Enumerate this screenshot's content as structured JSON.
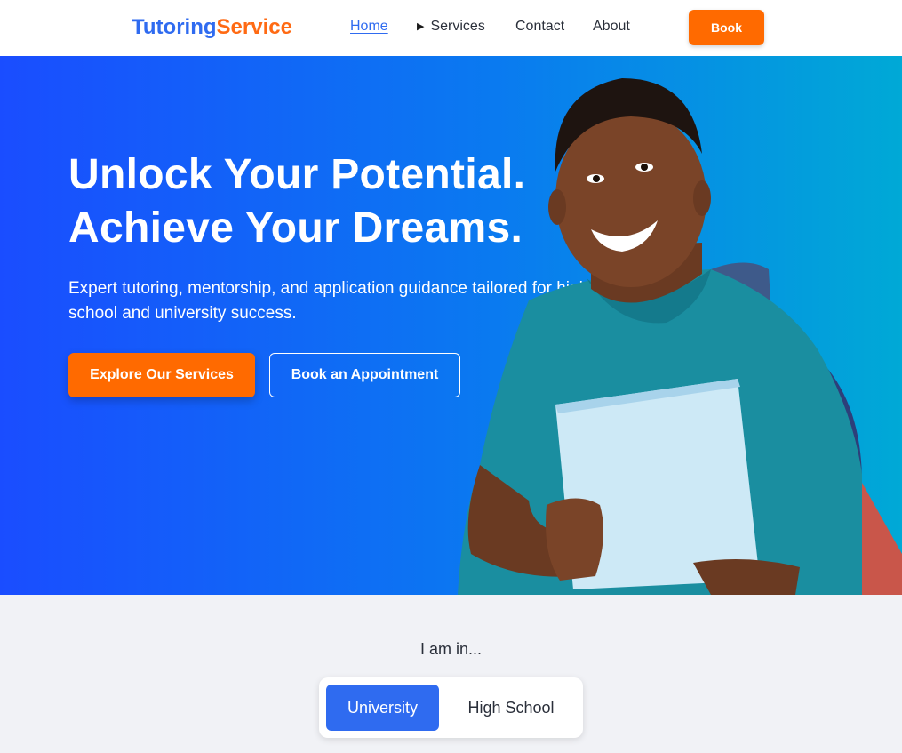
{
  "header": {
    "logo_part1": "Tutoring",
    "logo_part2": "Service",
    "nav": {
      "home": "Home",
      "services": "Services",
      "contact": "Contact",
      "about": "About"
    },
    "book_label": "Book"
  },
  "hero": {
    "headline_line1": "Unlock Your Potential.",
    "headline_line2": "Achieve Your Dreams.",
    "subtext": "Expert tutoring, mentorship, and application guidance tailored for high school and university success.",
    "explore_label": "Explore Our Services",
    "appointment_label": "Book an Appointment"
  },
  "level_selector": {
    "label": "I am in...",
    "options": [
      "University",
      "High School"
    ],
    "selected": "University"
  },
  "colors": {
    "brand_blue": "#2f6bf0",
    "brand_orange": "#ff6a00"
  }
}
